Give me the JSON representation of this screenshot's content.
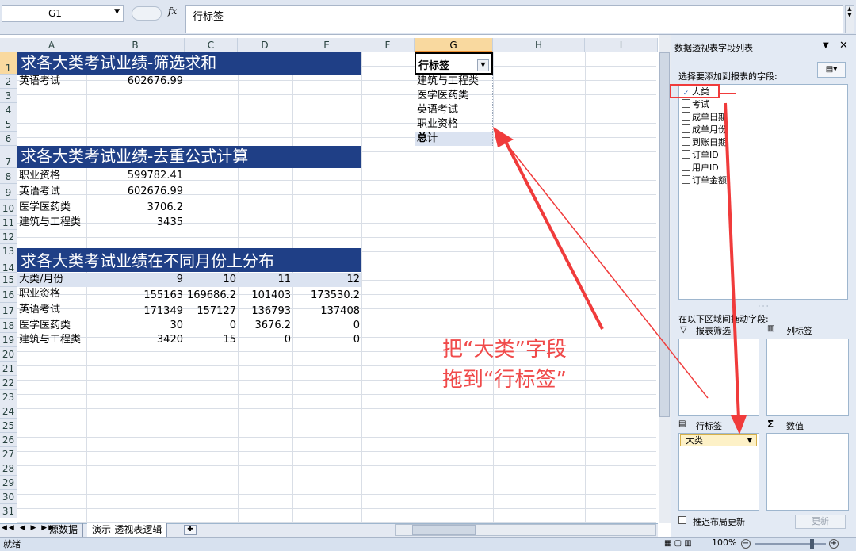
{
  "formula_bar": {
    "name_box": "G1",
    "fx_label": "fx",
    "formula": "行标签"
  },
  "columns": [
    "A",
    "B",
    "C",
    "D",
    "E",
    "F",
    "G",
    "H",
    "I"
  ],
  "rows": [
    "1",
    "2",
    "3",
    "4",
    "5",
    "6",
    "7",
    "8",
    "9",
    "10",
    "11",
    "12",
    "13",
    "14",
    "15",
    "16",
    "17",
    "18",
    "19",
    "20",
    "21",
    "22",
    "23",
    "24",
    "25",
    "26",
    "27",
    "28",
    "29",
    "30",
    "31"
  ],
  "section1": {
    "title": "求各大类考试业绩-筛选求和",
    "label": "英语考试",
    "value": "602676.99"
  },
  "section2": {
    "title": "求各大类考试业绩-去重公式计算",
    "rows": [
      {
        "label": "职业资格",
        "value": "599782.41"
      },
      {
        "label": "英语考试",
        "value": "602676.99"
      },
      {
        "label": "医学医药类",
        "value": "3706.2"
      },
      {
        "label": "建筑与工程类",
        "value": "3435"
      }
    ]
  },
  "section3": {
    "title": "求各大类考试业绩在不同月份上分布",
    "header": [
      "大类/月份",
      "9",
      "10",
      "11",
      "12"
    ],
    "rows": [
      [
        "职业资格",
        "155163",
        "169686.2",
        "101403",
        "173530.2"
      ],
      [
        "英语考试",
        "171349",
        "157127",
        "136793",
        "137408"
      ],
      [
        "医学医药类",
        "30",
        "0",
        "3676.2",
        "0"
      ],
      [
        "建筑与工程类",
        "3420",
        "15",
        "0",
        "0"
      ]
    ]
  },
  "pivot": {
    "header": "行标签",
    "items": [
      "建筑与工程类",
      "医学医药类",
      "英语考试",
      "职业资格"
    ],
    "total": "总计"
  },
  "sheets": {
    "tab1": "源数据",
    "tab2": "演示-透视表逻辑"
  },
  "status": {
    "ready": "就绪",
    "zoom": "100%"
  },
  "field_list": {
    "title": "数据透视表字段列表",
    "choose_label": "选择要添加到报表的字段:",
    "fields": [
      {
        "name": "大类",
        "checked": true
      },
      {
        "name": "考试",
        "checked": false
      },
      {
        "name": "成单日期",
        "checked": false
      },
      {
        "name": "成单月份",
        "checked": false
      },
      {
        "name": "到账日期",
        "checked": false
      },
      {
        "name": "订单ID",
        "checked": false
      },
      {
        "name": "用户ID",
        "checked": false
      },
      {
        "name": "订单金额",
        "checked": false
      }
    ],
    "drag_label": "在以下区域间拖动字段:",
    "filter_label": "报表筛选",
    "column_label": "列标签",
    "row_label": "行标签",
    "values_label": "数值",
    "row_chip": "大类",
    "defer_label": "推迟布局更新",
    "update_button": "更新"
  },
  "annotation": {
    "line1": "把“大类”字段",
    "line2": "拖到“行标签”",
    "color": "#f04a4a"
  }
}
